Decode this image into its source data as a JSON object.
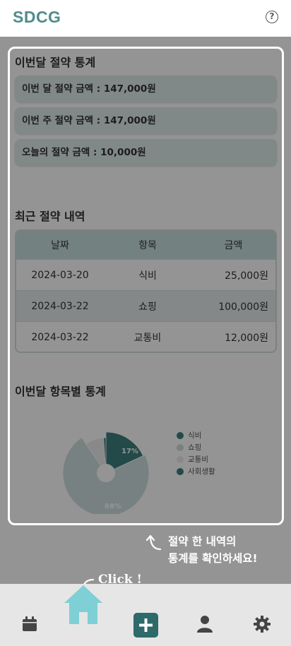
{
  "header": {
    "logo": "SDCG",
    "help_glyph": "?"
  },
  "monthly_stats": {
    "title": "이번달 절약 통계",
    "cards": [
      {
        "label": "이번 달 절약 금액 : 147,000원"
      },
      {
        "label": "이번 주 절약 금액 : 147,000원"
      },
      {
        "label": "오늘의 절약 금액 : 10,000원"
      }
    ]
  },
  "recent": {
    "title": "최근 절약 내역",
    "columns": [
      "날짜",
      "항목",
      "금액"
    ],
    "rows": [
      {
        "date": "2024-03-20",
        "item": "식비",
        "amount": "25,000원"
      },
      {
        "date": "2024-03-22",
        "item": "쇼핑",
        "amount": "100,000원"
      },
      {
        "date": "2024-03-22",
        "item": "교통비",
        "amount": "12,000원"
      }
    ]
  },
  "category_stats": {
    "title": "이번달 항목별 통계"
  },
  "chart_data": {
    "type": "pie",
    "categories": [
      "식비",
      "쇼핑",
      "교통비",
      "사회생활"
    ],
    "values": [
      17,
      68,
      8,
      1
    ],
    "labels_shown": [
      "17%",
      "68%"
    ],
    "colors": [
      "#3d7f7f",
      "#cfdede",
      "#ececec",
      "#3d7f7f"
    ],
    "legend": "right"
  },
  "tutorial": {
    "tip_line1": "절약 한 내역의",
    "tip_line2": "통계를 확인하세요!",
    "click_label": "Click !"
  },
  "nav": {
    "items": [
      "calendar-icon",
      "home-icon",
      "add-icon",
      "user-icon",
      "gear-icon"
    ],
    "active": "home-icon",
    "accent": "#7ecfd6"
  }
}
